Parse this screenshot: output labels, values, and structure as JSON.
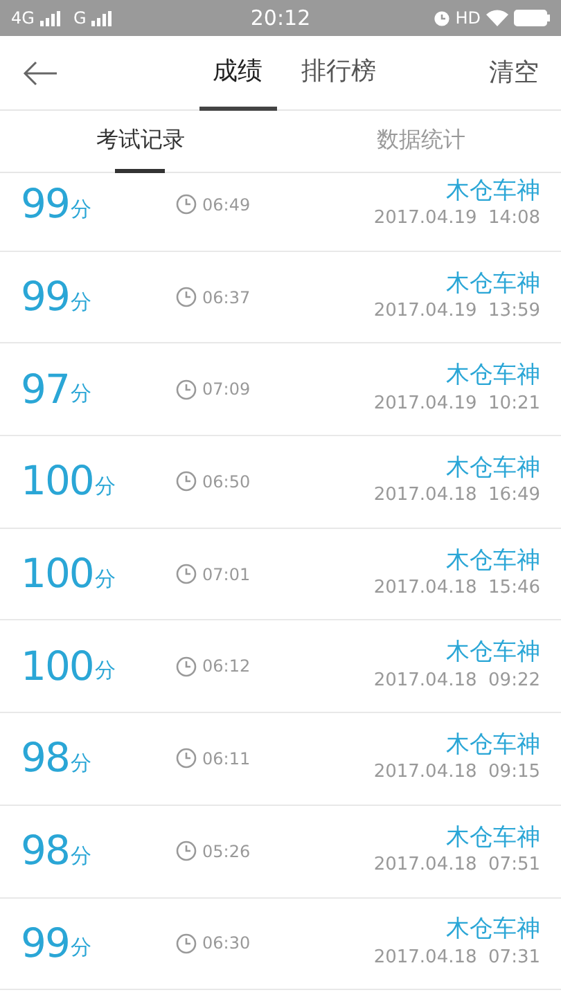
{
  "status_bar": {
    "network_1": "4G",
    "network_2": "G",
    "time": "20:12",
    "hd": "HD"
  },
  "header": {
    "tabs": [
      {
        "label": "成绩",
        "selected": true
      },
      {
        "label": "排行榜",
        "selected": false
      }
    ],
    "action": "清空"
  },
  "sub_tabs": [
    {
      "label": "考试记录",
      "selected": true
    },
    {
      "label": "数据统计",
      "selected": false
    }
  ],
  "records": [
    {
      "score": "99",
      "unit": "分",
      "duration": "06:49",
      "name": "木仓车神",
      "date": "2017.04.19  14:08"
    },
    {
      "score": "99",
      "unit": "分",
      "duration": "06:37",
      "name": "木仓车神",
      "date": "2017.04.19  13:59"
    },
    {
      "score": "97",
      "unit": "分",
      "duration": "07:09",
      "name": "木仓车神",
      "date": "2017.04.19  10:21"
    },
    {
      "score": "100",
      "unit": "分",
      "duration": "06:50",
      "name": "木仓车神",
      "date": "2017.04.18  16:49"
    },
    {
      "score": "100",
      "unit": "分",
      "duration": "07:01",
      "name": "木仓车神",
      "date": "2017.04.18  15:46"
    },
    {
      "score": "100",
      "unit": "分",
      "duration": "06:12",
      "name": "木仓车神",
      "date": "2017.04.18  09:22"
    },
    {
      "score": "98",
      "unit": "分",
      "duration": "06:11",
      "name": "木仓车神",
      "date": "2017.04.18  09:15"
    },
    {
      "score": "98",
      "unit": "分",
      "duration": "05:26",
      "name": "木仓车神",
      "date": "2017.04.18  07:51"
    },
    {
      "score": "99",
      "unit": "分",
      "duration": "06:30",
      "name": "木仓车神",
      "date": "2017.04.18  07:31"
    }
  ]
}
